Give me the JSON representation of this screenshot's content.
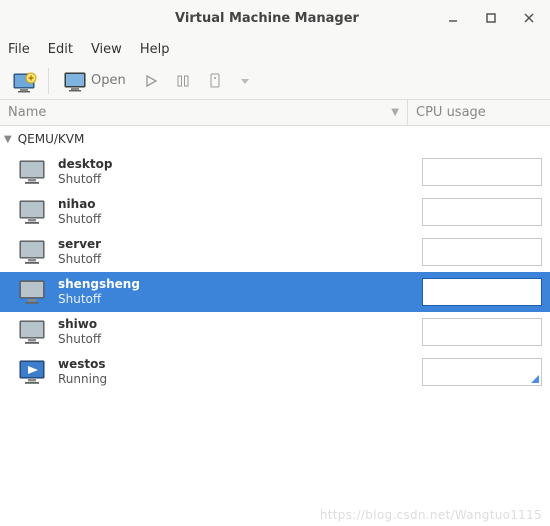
{
  "window": {
    "title": "Virtual Machine Manager"
  },
  "menu": {
    "file": "File",
    "edit": "Edit",
    "view": "View",
    "help": "Help"
  },
  "toolbar": {
    "open_label": "Open"
  },
  "headers": {
    "name": "Name",
    "cpu": "CPU usage"
  },
  "group": {
    "label": "QEMU/KVM"
  },
  "vms": [
    {
      "name": "desktop",
      "state": "Shutoff",
      "running": false,
      "selected": false
    },
    {
      "name": "nihao",
      "state": "Shutoff",
      "running": false,
      "selected": false
    },
    {
      "name": "server",
      "state": "Shutoff",
      "running": false,
      "selected": false
    },
    {
      "name": "shengsheng",
      "state": "Shutoff",
      "running": false,
      "selected": true
    },
    {
      "name": "shiwo",
      "state": "Shutoff",
      "running": false,
      "selected": false
    },
    {
      "name": "westos",
      "state": "Running",
      "running": true,
      "selected": false
    }
  ],
  "watermark": "https://blog.csdn.net/Wangtuo1115"
}
